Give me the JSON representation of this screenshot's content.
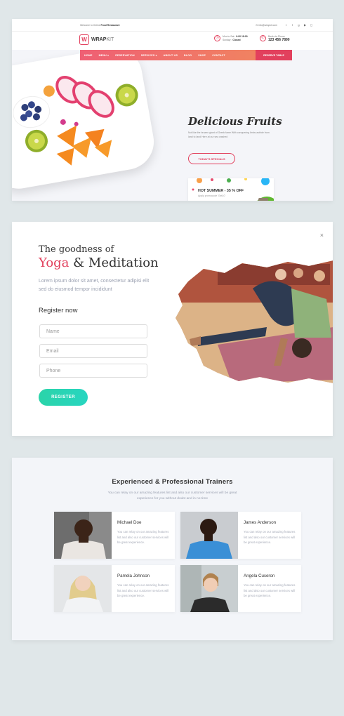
{
  "card1": {
    "topbar": {
      "welcome_prefix": "Welcome to Online ",
      "welcome_bold": "Food Restaurant",
      "email": "info@wrapkit.com",
      "socials": [
        "twitter-icon",
        "facebook-icon",
        "google-plus-icon",
        "youtube-icon",
        "instagram-icon"
      ]
    },
    "logo": {
      "mark": "W",
      "name": "WRAP",
      "name2": "KIT"
    },
    "hours": {
      "line1": "Mon to Sat",
      "time": "9:00 18:00",
      "line2": "Sunday",
      "closed": "Closed"
    },
    "phone": {
      "label": "Book via Phone",
      "number": "123 456 7890"
    },
    "nav": [
      "HOME",
      "MENU ▾",
      "RESERVATION",
      "SERVICES ▾",
      "ABOUT US",
      "BLOG",
      "SHOP",
      "CONTACT"
    ],
    "nav_button": "RESERVE TABLE",
    "hero": {
      "title": "Delicious Fruits",
      "subtitle": "Not like the brazen giant of Greek fame With conquering limbs astride from land to land Here at our sea washed",
      "button": "TODAY'S SPECIALS"
    },
    "promo": {
      "title": "HOT SUMMER - 35 % OFF",
      "subtitle": "Apply promocode 'Get10'"
    },
    "colors": {
      "accent": "#e2405d",
      "nav_start": "#ef5f74",
      "nav_end": "#f08a5d"
    }
  },
  "card2": {
    "close": "×",
    "pre": "The goodness of",
    "title_pink": "Yoga",
    "title_amp": " & ",
    "title_rest": "Meditation",
    "description": "Lorem ipsum dolor sit amet, consectetur adipisi elit sed do eiusmod tempor incididunt",
    "register_title": "Register now",
    "fields": {
      "name": "Name",
      "email": "Email",
      "phone": "Phone"
    },
    "button": "REGISTER",
    "colors": {
      "accent": "#e2405d",
      "button": "#2ad4a9"
    }
  },
  "card3": {
    "title": "Experienced & Professional Trainers",
    "description": "You can relay on our amazing features list and also our customer services will be great experience for you without doubt and in no-time",
    "trainers": [
      {
        "name": "Michael Doe",
        "text": "You can relay on our amazing features list and also our customer services will be great experience."
      },
      {
        "name": "James Anderson",
        "text": "You can relay on our amazing features list and also our customer services will be great experience."
      },
      {
        "name": "Pamela Johnson",
        "text": "You can relay on our amazing features list and also our customer services will be great experience."
      },
      {
        "name": "Angela Cuseron",
        "text": "You can relay on our amazing features list and also our customer services will be great experience."
      }
    ]
  }
}
